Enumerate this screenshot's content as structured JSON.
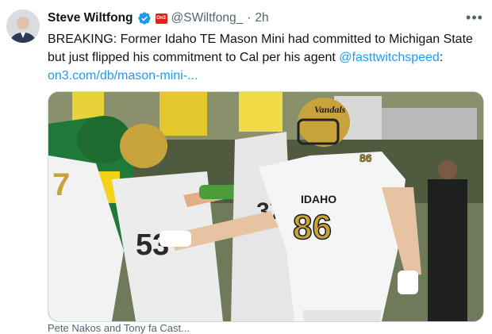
{
  "author": {
    "name": "Steve Wiltfong",
    "handle": "@SWiltfong_",
    "separator": "·",
    "time": "2h",
    "affiliation_badge": "On3"
  },
  "tweet": {
    "text": "BREAKING: Former Idaho TE Mason Mini had committed to Michigan State but just flipped his commitment to Cal per his agent ",
    "mention": "@fasttwitchspeed",
    "after_mention": ":",
    "link": "on3.com/db/mason-mini-..."
  },
  "media": {
    "jersey_team": "IDAHO",
    "jersey_number": "86",
    "helmet_text": "Vandals",
    "opponent_number_1": "53",
    "opponent_number_2": "37",
    "opponent_number_3": "7"
  },
  "footer": {
    "partial_text": "Pete Nakos and Tony fa Cast..."
  },
  "colors": {
    "verified_blue": "#1d9bf0",
    "link_blue": "#1d9bf0",
    "idaho_gold": "#c8a23a",
    "oregon_green": "#1f7a3a",
    "oregon_yellow": "#f2d21b"
  },
  "icons": [
    "verified-badge-icon",
    "more-options-icon",
    "affiliation-badge-icon"
  ]
}
